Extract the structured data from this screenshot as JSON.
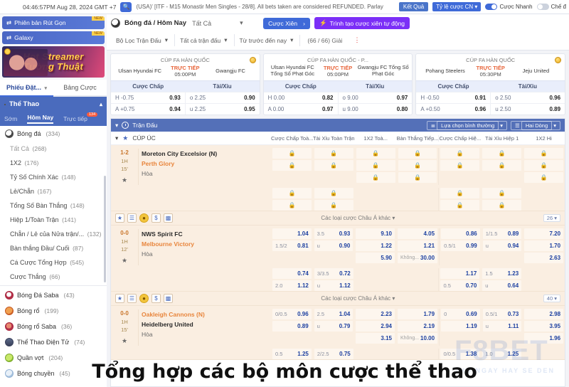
{
  "topbar": {
    "clock": "04:46:57PM Aug 28, 2024 GMT +7",
    "search_icon": "search-icon",
    "marquee": "(USA)' [ITF - M15 Monastir Men Singles - 28/8]. All bets taken are considered REFUNDED. Parlay",
    "result_btn": "Kết Quả",
    "odds_btn": "Tỷ lệ cược CN",
    "quick_bet_label": "Cược Nhanh",
    "mode_label": "Chế đ"
  },
  "sidebar": {
    "promos": [
      {
        "label": "Phiên bản Rút Gọn",
        "badge": "NEW"
      },
      {
        "label": "Galaxy",
        "badge": "NEW"
      }
    ],
    "banner": {
      "line1": "Hot Streamer",
      "line2": "Tường Thuật"
    },
    "tabs": [
      {
        "label": "Phiếu Đặt...",
        "active": true
      },
      {
        "label": "Bảng Cược",
        "active": false
      }
    ],
    "sport_header": "Thể Thao",
    "sub_tabs": [
      {
        "label": "Sớm",
        "active": false
      },
      {
        "label": "Hôm Nay",
        "active": true
      },
      {
        "label": "Trực tiếp",
        "active": false,
        "badge": "134"
      }
    ],
    "group": {
      "label": "Bóng đá",
      "count": "(334)"
    },
    "items": [
      {
        "label": "Tất Cả",
        "count": "(268)",
        "dim": true
      },
      {
        "label": "1X2",
        "count": "(176)",
        "dim": false
      },
      {
        "label": "Tỷ Số Chính Xác",
        "count": "(148)",
        "dim": false
      },
      {
        "label": "Lẻ/Chẵn",
        "count": "(167)",
        "dim": false
      },
      {
        "label": "Tổng Số Bàn Thắng",
        "count": "(148)",
        "dim": false
      },
      {
        "label": "Hiệp 1/Toàn Trận",
        "count": "(141)",
        "dim": false
      },
      {
        "label": "Chẵn / Lẻ của Nửa trận/...",
        "count": "(132)",
        "dim": false
      },
      {
        "label": "Bàn thắng Đầu/ Cuối",
        "count": "(87)",
        "dim": false
      },
      {
        "label": "Cá Cược Tổng Hợp",
        "count": "(545)",
        "dim": false
      },
      {
        "label": "Cược Thắng",
        "count": "(66)",
        "dim": false
      }
    ],
    "sports": [
      {
        "label": "Bóng Đá Saba",
        "count": "(43)",
        "icon": "soccer-saba-icon"
      },
      {
        "label": "Bóng rổ",
        "count": "(199)",
        "icon": "basketball-icon"
      },
      {
        "label": "Bóng rổ Saba",
        "count": "(36)",
        "icon": "basketball-saba-icon"
      },
      {
        "label": "Thể Thao Điện Tử",
        "count": "(74)",
        "icon": "esports-icon"
      },
      {
        "label": "Quần vợt",
        "count": "(204)",
        "icon": "tennis-icon"
      },
      {
        "label": "Bóng chuyền",
        "count": "(45)",
        "icon": "volleyball-icon"
      }
    ]
  },
  "main_header": {
    "title": "Bóng đá / Hôm Nay",
    "league_select": "Tất Cả",
    "parlay_btn": "Cược Xiên",
    "auto_parlay_btn": "Trình tạo cược xiên tự động",
    "filters": [
      "Bộ Lọc Trận Đấu",
      "Tất cả trận đấu",
      "Từ trước đến nay"
    ],
    "games_count": "(66 / 66) Giải"
  },
  "cards": [
    {
      "league": "CÚP FA HÀN QUỐC",
      "home": "Ulsan Hyundai FC",
      "away": "Gwangju FC",
      "live_label": "TRỰC TIẾP",
      "time": "05:00PM",
      "col1": "Cược Chấp",
      "col2": "Tài/Xỉu",
      "rows": [
        {
          "h_lbl": "H -0.75",
          "h_val": "0.93",
          "o_lbl": "o 2.25",
          "o_val": "0.90"
        },
        {
          "h_lbl": "A +0.75",
          "h_val": "0.94",
          "o_lbl": "u 2.25",
          "o_val": "0.95"
        }
      ],
      "coin": true
    },
    {
      "league": "CÚP FA HÀN QUỐC - P...",
      "home": "Ulsan Hyundai FC Tổng Số Phạt Góc",
      "away": "Gwangju FC Tổng Số Phạt Góc",
      "live_label": "TRỰC TIẾP",
      "time": "05:00PM",
      "col1": "Cược Chấp",
      "col2": "Tài/Xỉu",
      "rows": [
        {
          "h_lbl": "H 0.00",
          "h_val": "0.82",
          "o_lbl": "o 9.00",
          "o_val": "0.97"
        },
        {
          "h_lbl": "A 0.00",
          "h_val": "0.97",
          "o_lbl": "u 9.00",
          "o_val": "0.80"
        }
      ],
      "coin": false
    },
    {
      "league": "CÚP FA HÀN QUỐC",
      "home": "Pohang Steelers",
      "away": "Jeju United",
      "live_label": "TRỰC TIẾP",
      "time": "05:30PM",
      "col1": "Cược Chấp",
      "col2": "Tài/Xỉu",
      "rows": [
        {
          "h_lbl": "H -0.50",
          "h_val": "0.91",
          "o_lbl": "o 2.50",
          "o_val": "0.96"
        },
        {
          "h_lbl": "A +0.50",
          "h_val": "0.96",
          "o_lbl": "u 2.50",
          "o_val": "0.89"
        }
      ],
      "coin": true
    }
  ],
  "table": {
    "bar_title": "Trận Đấu",
    "bar_right": [
      "Lựa chọn bình thường",
      "Hai Dòng"
    ],
    "league_row": "CÚP ÚC",
    "columns": [
      "Cược Chấp Toà...",
      "Tài Xỉu Toàn Trận",
      "1X2 Toà...",
      "Bàn Thắng Tiếp...",
      "Cược Chấp Hiệ...",
      "Tài Xỉu Hiệp 1",
      "1X2 Hi"
    ],
    "footer_more": "Các loại cược Châu Á khác",
    "matches": [
      {
        "score": "1-2",
        "half": "1H",
        "minute": "15'",
        "home": "Moreton City Excelsior (N)",
        "away": "Perth Glory",
        "draw": "Hòa",
        "locked": true,
        "count": "26",
        "odds": []
      },
      {
        "score": "0-0",
        "half": "1H",
        "minute": "12'",
        "home": "NWS Spirit FC",
        "away": "Melbourne Victory",
        "draw": "Hòa",
        "locked": false,
        "count": "40",
        "odds": [
          {
            "col": "ah_ft",
            "rows": [
              {
                "lbl": "",
                "val": "1.04"
              },
              {
                "lbl": "1.5/2",
                "val": "0.81"
              },
              {
                "lbl": "",
                "val": ""
              }
            ]
          },
          {
            "col": "ou_ft",
            "rows": [
              {
                "lbl": "3.5",
                "val": "0.93"
              },
              {
                "lbl": "u",
                "val": "0.90"
              },
              {
                "lbl": "",
                "val": ""
              }
            ]
          },
          {
            "col": "1x2_ft",
            "rows": [
              {
                "lbl": "",
                "val": "9.10"
              },
              {
                "lbl": "",
                "val": "1.22"
              },
              {
                "lbl": "",
                "val": "5.90"
              }
            ]
          },
          {
            "col": "next_goal",
            "rows": [
              {
                "lbl": "",
                "val": "4.05"
              },
              {
                "lbl": "",
                "val": "1.21"
              },
              {
                "lbl": "Không...",
                "val": "30.00"
              }
            ]
          },
          {
            "col": "ah_1h",
            "rows": [
              {
                "lbl": "",
                "val": "0.86"
              },
              {
                "lbl": "0.5/1",
                "val": "0.99"
              },
              {
                "lbl": "",
                "val": ""
              }
            ]
          },
          {
            "col": "ou_1h",
            "rows": [
              {
                "lbl": "1/1.5",
                "val": "0.89"
              },
              {
                "lbl": "u",
                "val": "0.94"
              },
              {
                "lbl": "",
                "val": ""
              }
            ]
          },
          {
            "col": "1x2_1h",
            "rows": [
              {
                "lbl": "",
                "val": "7.20"
              },
              {
                "lbl": "",
                "val": "1.70"
              },
              {
                "lbl": "",
                "val": "2.63"
              }
            ]
          }
        ],
        "odds2": [
          {
            "col": "ah_ft",
            "rows": [
              {
                "lbl": "",
                "val": "0.74"
              },
              {
                "lbl": "2.0",
                "val": "1.12"
              }
            ]
          },
          {
            "col": "ou_ft",
            "rows": [
              {
                "lbl": "3/3.5",
                "val": "0.72"
              },
              {
                "lbl": "u",
                "val": "1.12"
              }
            ]
          },
          {
            "col": "1x2_ft",
            "rows": [
              {
                "lbl": "",
                "val": ""
              },
              {
                "lbl": "",
                "val": ""
              }
            ]
          },
          {
            "col": "next_goal",
            "rows": [
              {
                "lbl": "",
                "val": ""
              },
              {
                "lbl": "",
                "val": ""
              }
            ]
          },
          {
            "col": "ah_1h",
            "rows": [
              {
                "lbl": "",
                "val": "1.17"
              },
              {
                "lbl": "0.5",
                "val": "0.70"
              }
            ]
          },
          {
            "col": "ou_1h",
            "rows": [
              {
                "lbl": "1.5",
                "val": "1.23"
              },
              {
                "lbl": "u",
                "val": "0.64"
              }
            ]
          },
          {
            "col": "1x2_1h",
            "rows": [
              {
                "lbl": "",
                "val": ""
              },
              {
                "lbl": "",
                "val": ""
              }
            ]
          }
        ]
      },
      {
        "score": "0-0",
        "half": "1H",
        "minute": "15'",
        "home": "Oakleigh Cannons (N)",
        "away": "Heidelberg United",
        "draw": "Hòa",
        "locked": false,
        "count": "",
        "odds": [
          {
            "col": "ah_ft",
            "rows": [
              {
                "lbl": "0/0.5",
                "val": "0.96"
              },
              {
                "lbl": "",
                "val": "0.89"
              },
              {
                "lbl": "",
                "val": ""
              }
            ]
          },
          {
            "col": "ou_ft",
            "rows": [
              {
                "lbl": "2.5",
                "val": "1.04"
              },
              {
                "lbl": "u",
                "val": "0.79"
              },
              {
                "lbl": "",
                "val": ""
              }
            ]
          },
          {
            "col": "1x2_ft",
            "rows": [
              {
                "lbl": "",
                "val": "2.23"
              },
              {
                "lbl": "",
                "val": "2.94"
              },
              {
                "lbl": "",
                "val": "3.15"
              }
            ]
          },
          {
            "col": "next_goal",
            "rows": [
              {
                "lbl": "",
                "val": "1.79"
              },
              {
                "lbl": "",
                "val": "2.19"
              },
              {
                "lbl": "Không...",
                "val": "10.00"
              }
            ]
          },
          {
            "col": "ah_1h",
            "rows": [
              {
                "lbl": "0",
                "val": "0.69"
              },
              {
                "lbl": "",
                "val": "1.19"
              },
              {
                "lbl": "",
                "val": ""
              }
            ]
          },
          {
            "col": "ou_1h",
            "rows": [
              {
                "lbl": "0.5/1",
                "val": "0.73"
              },
              {
                "lbl": "u",
                "val": "1.11"
              },
              {
                "lbl": "",
                "val": ""
              }
            ]
          },
          {
            "col": "1x2_1h",
            "rows": [
              {
                "lbl": "",
                "val": "2.98"
              },
              {
                "lbl": "",
                "val": "3.95"
              },
              {
                "lbl": "",
                "val": "1.96"
              }
            ]
          }
        ],
        "odds2": [
          {
            "col": "ah_ft",
            "rows": [
              {
                "lbl": "0.5",
                "val": "1.25"
              },
              {
                "lbl": "",
                "val": ""
              }
            ]
          },
          {
            "col": "ou_ft",
            "rows": [
              {
                "lbl": "2/2.5",
                "val": "0.75"
              },
              {
                "lbl": "",
                "val": ""
              }
            ]
          },
          {
            "col": "1x2_ft",
            "rows": [
              {
                "lbl": "",
                "val": ""
              },
              {
                "lbl": "",
                "val": ""
              }
            ]
          },
          {
            "col": "next_goal",
            "rows": [
              {
                "lbl": "",
                "val": ""
              },
              {
                "lbl": "",
                "val": ""
              }
            ]
          },
          {
            "col": "ah_1h",
            "rows": [
              {
                "lbl": "0/0.5",
                "val": "1.38"
              },
              {
                "lbl": "",
                "val": ""
              }
            ]
          },
          {
            "col": "ou_1h",
            "rows": [
              {
                "lbl": "1.0",
                "val": "1.25"
              },
              {
                "lbl": "",
                "val": ""
              }
            ]
          },
          {
            "col": "1x2_1h",
            "rows": [
              {
                "lbl": "",
                "val": ""
              },
              {
                "lbl": "",
                "val": ""
              }
            ]
          }
        ]
      }
    ]
  },
  "watermark": {
    "text": "F8BET",
    "sub": "THO NGAY HAY SE DEN"
  },
  "caption": "Tổng hợp các bộ môn cược thể thao",
  "colors": {
    "accent_blue": "#3f6ad8",
    "header_blue": "#4a6bbd",
    "purple": "#7b2ff7",
    "match_bg": "#faeee1",
    "odds_value": "#1b3fa0",
    "away_orange": "#e8853c"
  }
}
